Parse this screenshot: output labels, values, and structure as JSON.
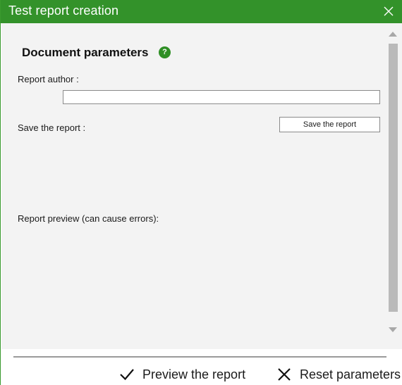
{
  "window": {
    "title": "Test report creation",
    "close_icon": "close-icon"
  },
  "colors": {
    "titlebar": "#33922a",
    "content_bg": "#f3f3f3",
    "help_icon": "#2f8f25"
  },
  "document": {
    "section_title": "Document parameters",
    "help_glyph": "?",
    "author_label": "Report author :",
    "author_value": "",
    "save_label": "Save the report :",
    "save_button": "Save the report",
    "preview_label": "Report preview (can cause errors):"
  },
  "footer": {
    "preview_button": "Preview the report",
    "preview_icon": "checkmark-icon",
    "reset_button": "Reset parameters",
    "reset_icon": "close-icon"
  }
}
